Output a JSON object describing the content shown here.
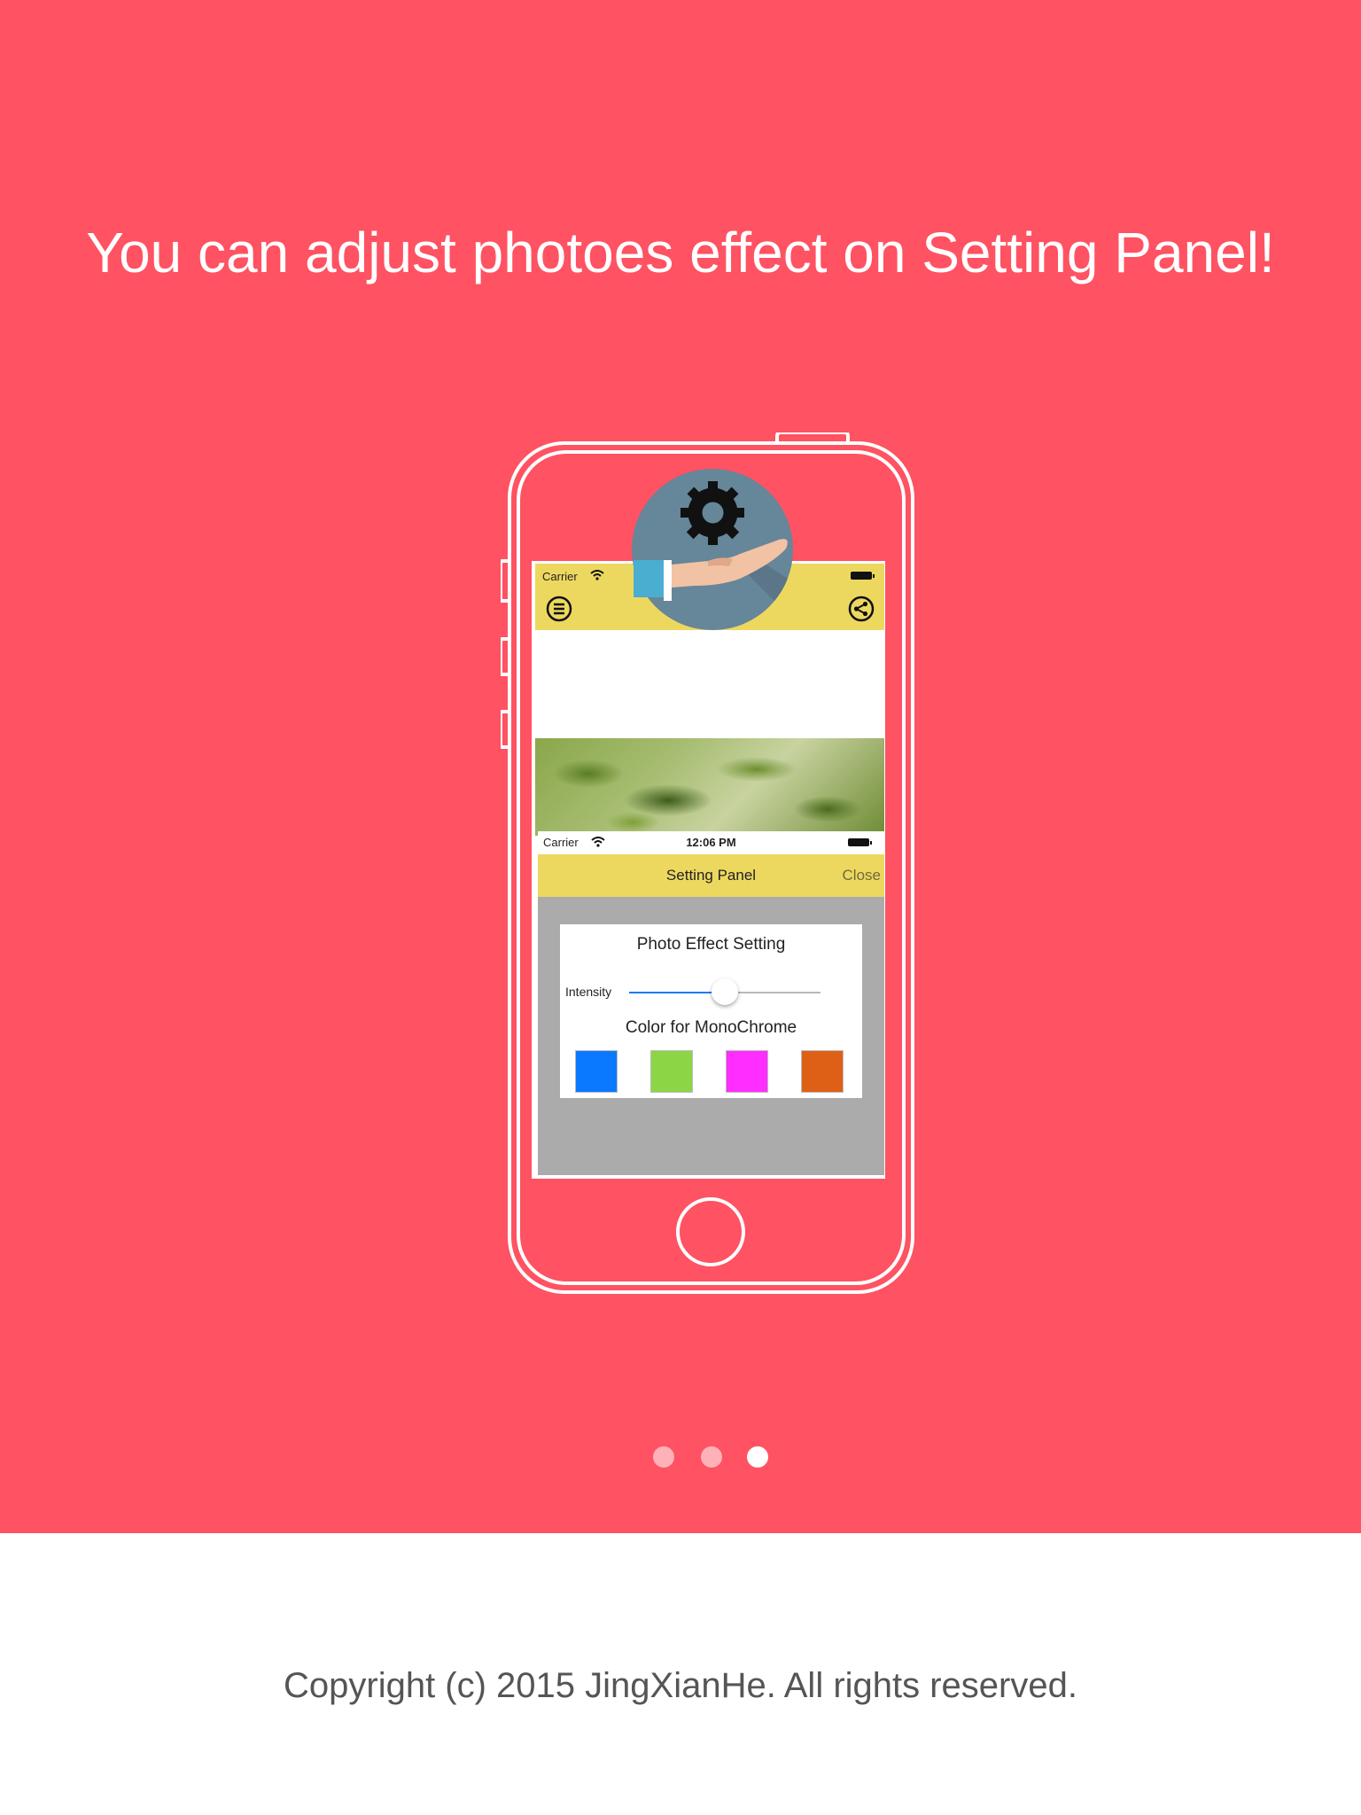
{
  "headline": "You can adjust photoes effect on Setting Panel!",
  "phone": {
    "status_bar": {
      "carrier": "Carrier"
    },
    "app_bar": {
      "menu_icon": "hamburger-circle-icon",
      "share_icon": "share-circle-icon"
    },
    "badge_icons": [
      "gear-icon",
      "hand-icon"
    ],
    "setting_panel": {
      "status_bar": {
        "carrier": "Carrier",
        "time": "12:06 PM"
      },
      "nav_title": "Setting Panel",
      "close_label": "Close",
      "card": {
        "title": "Photo Effect Setting",
        "intensity_label": "Intensity",
        "intensity_value": 0.5,
        "color_heading": "Color for MonoChrome",
        "swatches": [
          "#0a78ff",
          "#8cd646",
          "#ff2dff",
          "#de6016"
        ]
      }
    }
  },
  "pager": {
    "count": 3,
    "active_index": 2
  },
  "footer": "Copyright (c) 2015 JingXianHe. All rights reserved.",
  "colors": {
    "background": "#ff5262",
    "app_yellow": "#edd85f",
    "panel_gray": "#ababab",
    "footer_bg": "#ffffff"
  }
}
